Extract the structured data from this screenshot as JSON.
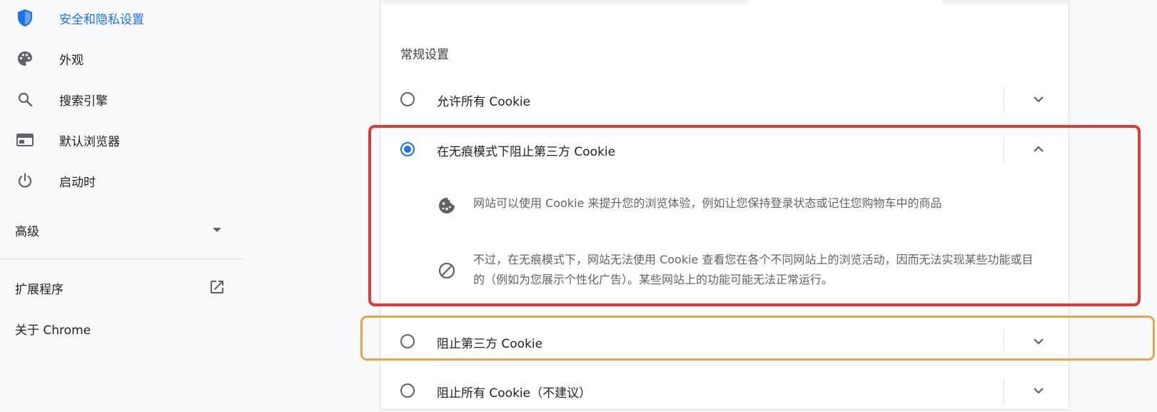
{
  "sidebar": {
    "items": [
      {
        "label": "安全和隐私设置",
        "icon": "shield-icon",
        "active": true
      },
      {
        "label": "外观",
        "icon": "palette-icon"
      },
      {
        "label": "搜索引擎",
        "icon": "search-icon"
      },
      {
        "label": "默认浏览器",
        "icon": "browser-icon"
      },
      {
        "label": "启动时",
        "icon": "power-icon"
      }
    ],
    "advanced_label": "高级",
    "extensions_label": "扩展程序",
    "about_label": "关于 Chrome"
  },
  "colors": {
    "accent": "#1a73e8",
    "red_frame": "#e03a32",
    "orange_frame": "#e7a44a"
  },
  "main": {
    "section_title": "常规设置",
    "options": [
      {
        "label": "允许所有 Cookie",
        "selected": false,
        "expanded": false
      },
      {
        "label": "在无痕模式下阻止第三方 Cookie",
        "selected": true,
        "expanded": true,
        "details": [
          {
            "icon": "cookie-icon",
            "text": "网站可以使用 Cookie 来提升您的浏览体验，例如让您保持登录状态或记住您购物车中的商品"
          },
          {
            "icon": "block-icon",
            "text": "不过，在无痕模式下，网站无法使用 Cookie 查看您在各个不同网站上的浏览活动，因而无法实现某些功能或目的（例如为您展示个性化广告）。某些网站上的功能可能无法正常运行。"
          }
        ]
      },
      {
        "label": "阻止第三方 Cookie",
        "selected": false,
        "expanded": false
      },
      {
        "label": "阻止所有 Cookie（不建议）",
        "selected": false,
        "expanded": false
      }
    ]
  }
}
